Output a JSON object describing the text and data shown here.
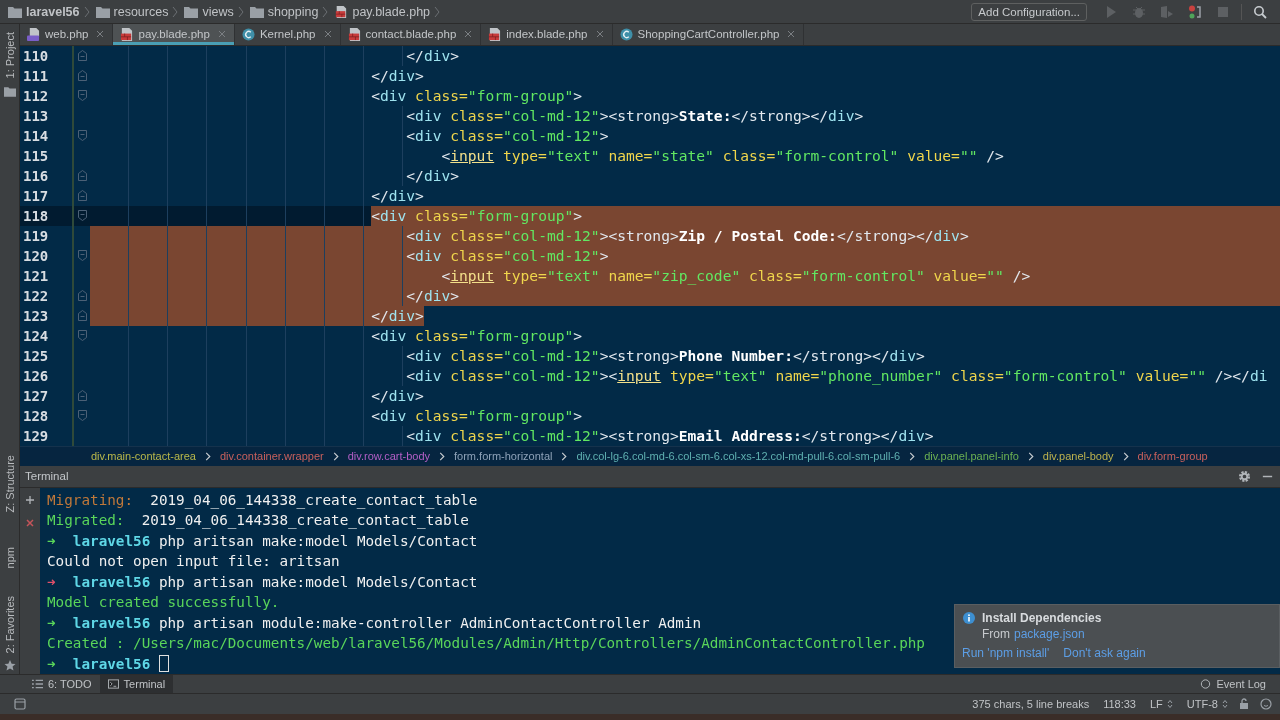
{
  "navbar": {
    "path": [
      {
        "label": "laravel56",
        "kind": "project"
      },
      {
        "label": "resources",
        "kind": "folder"
      },
      {
        "label": "views",
        "kind": "folder"
      },
      {
        "label": "shopping",
        "kind": "folder"
      },
      {
        "label": "pay.blade.php",
        "kind": "blade"
      }
    ],
    "config_button": "Add Configuration..."
  },
  "tool_strip": {
    "top": "1: Project",
    "bottom": [
      "Z: Structure",
      "npm",
      "2: Favorites"
    ]
  },
  "tabs": [
    {
      "label": "web.php",
      "kind": "php",
      "selected": false
    },
    {
      "label": "pay.blade.php",
      "kind": "blade",
      "selected": true
    },
    {
      "label": "Kernel.php",
      "kind": "class",
      "selected": false
    },
    {
      "label": "contact.blade.php",
      "kind": "blade",
      "selected": false
    },
    {
      "label": "index.blade.php",
      "kind": "blade",
      "selected": false
    },
    {
      "label": "ShoppingCartController.php",
      "kind": "class",
      "selected": false
    }
  ],
  "editor": {
    "lines": [
      {
        "number": "110",
        "fold_start": false,
        "fold_end": true,
        "current": false,
        "selected": false,
        "tokens": [
          {
            "kind": "p",
            "text": "                                    </"
          },
          {
            "kind": "tag",
            "text": "div"
          },
          {
            "kind": "p",
            "text": ">"
          }
        ]
      },
      {
        "number": "111",
        "fold_start": false,
        "fold_end": true,
        "current": false,
        "selected": false,
        "tokens": [
          {
            "kind": "p",
            "text": "                                </"
          },
          {
            "kind": "tag",
            "text": "div"
          },
          {
            "kind": "p",
            "text": ">"
          }
        ]
      },
      {
        "number": "112",
        "fold_start": true,
        "fold_end": false,
        "current": false,
        "selected": false,
        "tokens": [
          {
            "kind": "p",
            "text": "                                <"
          },
          {
            "kind": "tag",
            "text": "div"
          },
          {
            "kind": "attr",
            "text": " class="
          },
          {
            "kind": "str",
            "text": "\"form-group\""
          },
          {
            "kind": "p",
            "text": ">"
          }
        ]
      },
      {
        "number": "113",
        "fold_start": false,
        "fold_end": false,
        "current": false,
        "selected": false,
        "tokens": [
          {
            "kind": "p",
            "text": "                                    <"
          },
          {
            "kind": "tag",
            "text": "div"
          },
          {
            "kind": "attr",
            "text": " class="
          },
          {
            "kind": "str",
            "text": "\"col-md-12\""
          },
          {
            "kind": "p",
            "text": "><strong>"
          },
          {
            "kind": "txt",
            "text": "State:"
          },
          {
            "kind": "p",
            "text": "</strong></"
          },
          {
            "kind": "tag",
            "text": "div"
          },
          {
            "kind": "p",
            "text": ">"
          }
        ]
      },
      {
        "number": "114",
        "fold_start": true,
        "fold_end": false,
        "current": false,
        "selected": false,
        "tokens": [
          {
            "kind": "p",
            "text": "                                    <"
          },
          {
            "kind": "tag",
            "text": "div"
          },
          {
            "kind": "attr",
            "text": " class="
          },
          {
            "kind": "str",
            "text": "\"col-md-12\""
          },
          {
            "kind": "p",
            "text": ">"
          }
        ]
      },
      {
        "number": "115",
        "fold_start": false,
        "fold_end": false,
        "current": false,
        "selected": false,
        "tokens": [
          {
            "kind": "p",
            "text": "                                        <"
          },
          {
            "kind": "in",
            "text": "input"
          },
          {
            "kind": "attr",
            "text": " type="
          },
          {
            "kind": "str",
            "text": "\"text\""
          },
          {
            "kind": "attr",
            "text": " name="
          },
          {
            "kind": "str",
            "text": "\"state\""
          },
          {
            "kind": "attr",
            "text": " class="
          },
          {
            "kind": "str",
            "text": "\"form-control\""
          },
          {
            "kind": "attr",
            "text": " value="
          },
          {
            "kind": "str",
            "text": "\"\""
          },
          {
            "kind": "p",
            "text": " />"
          }
        ]
      },
      {
        "number": "116",
        "fold_start": false,
        "fold_end": true,
        "current": false,
        "selected": false,
        "tokens": [
          {
            "kind": "p",
            "text": "                                    </"
          },
          {
            "kind": "tag",
            "text": "div"
          },
          {
            "kind": "p",
            "text": ">"
          }
        ]
      },
      {
        "number": "117",
        "fold_start": false,
        "fold_end": true,
        "current": false,
        "selected": false,
        "tokens": [
          {
            "kind": "p",
            "text": "                                </"
          },
          {
            "kind": "tag",
            "text": "div"
          },
          {
            "kind": "p",
            "text": ">"
          }
        ]
      },
      {
        "number": "118",
        "fold_start": true,
        "fold_end": false,
        "current": true,
        "selected": true,
        "tokens": [
          {
            "kind": "p",
            "text": "                                <"
          },
          {
            "kind": "tag",
            "text": "div"
          },
          {
            "kind": "attr",
            "text": " class="
          },
          {
            "kind": "str",
            "text": "\"form-group\""
          },
          {
            "kind": "p",
            "text": ">"
          }
        ]
      },
      {
        "number": "119",
        "fold_start": false,
        "fold_end": false,
        "current": false,
        "selected": true,
        "tokens": [
          {
            "kind": "p",
            "text": "                                    <"
          },
          {
            "kind": "tag",
            "text": "div"
          },
          {
            "kind": "attr",
            "text": " class="
          },
          {
            "kind": "str",
            "text": "\"col-md-12\""
          },
          {
            "kind": "p",
            "text": "><strong>"
          },
          {
            "kind": "txt",
            "text": "Zip / Postal Code:"
          },
          {
            "kind": "p",
            "text": "</strong></"
          },
          {
            "kind": "tag",
            "text": "div"
          },
          {
            "kind": "p",
            "text": ">"
          }
        ]
      },
      {
        "number": "120",
        "fold_start": true,
        "fold_end": false,
        "current": false,
        "selected": true,
        "tokens": [
          {
            "kind": "p",
            "text": "                                    <"
          },
          {
            "kind": "tag",
            "text": "div"
          },
          {
            "kind": "attr",
            "text": " class="
          },
          {
            "kind": "str",
            "text": "\"col-md-12\""
          },
          {
            "kind": "p",
            "text": ">"
          }
        ]
      },
      {
        "number": "121",
        "fold_start": false,
        "fold_end": false,
        "current": false,
        "selected": true,
        "tokens": [
          {
            "kind": "p",
            "text": "                                        <"
          },
          {
            "kind": "in",
            "text": "input"
          },
          {
            "kind": "attr",
            "text": " type="
          },
          {
            "kind": "str",
            "text": "\"text\""
          },
          {
            "kind": "attr",
            "text": " name="
          },
          {
            "kind": "str",
            "text": "\"zip_code\""
          },
          {
            "kind": "attr",
            "text": " class="
          },
          {
            "kind": "str",
            "text": "\"form-control\""
          },
          {
            "kind": "attr",
            "text": " value="
          },
          {
            "kind": "str",
            "text": "\"\""
          },
          {
            "kind": "p",
            "text": " />"
          }
        ]
      },
      {
        "number": "122",
        "fold_start": false,
        "fold_end": true,
        "current": false,
        "selected": true,
        "tokens": [
          {
            "kind": "p",
            "text": "                                    </"
          },
          {
            "kind": "tag",
            "text": "div"
          },
          {
            "kind": "p",
            "text": ">"
          }
        ]
      },
      {
        "number": "123",
        "fold_start": false,
        "fold_end": true,
        "current": false,
        "selected": true,
        "tokens": [
          {
            "kind": "p",
            "text": "                                </"
          },
          {
            "kind": "tag",
            "text": "div"
          },
          {
            "kind": "p",
            "text": ">"
          }
        ]
      },
      {
        "number": "124",
        "fold_start": true,
        "fold_end": false,
        "current": false,
        "selected": false,
        "tokens": [
          {
            "kind": "p",
            "text": "                                <"
          },
          {
            "kind": "tag",
            "text": "div"
          },
          {
            "kind": "attr",
            "text": " class="
          },
          {
            "kind": "str",
            "text": "\"form-group\""
          },
          {
            "kind": "p",
            "text": ">"
          }
        ]
      },
      {
        "number": "125",
        "fold_start": false,
        "fold_end": false,
        "current": false,
        "selected": false,
        "tokens": [
          {
            "kind": "p",
            "text": "                                    <"
          },
          {
            "kind": "tag",
            "text": "div"
          },
          {
            "kind": "attr",
            "text": " class="
          },
          {
            "kind": "str",
            "text": "\"col-md-12\""
          },
          {
            "kind": "p",
            "text": "><strong>"
          },
          {
            "kind": "txt",
            "text": "Phone Number:"
          },
          {
            "kind": "p",
            "text": "</strong></"
          },
          {
            "kind": "tag",
            "text": "div"
          },
          {
            "kind": "p",
            "text": ">"
          }
        ]
      },
      {
        "number": "126",
        "fold_start": false,
        "fold_end": false,
        "current": false,
        "selected": false,
        "tokens": [
          {
            "kind": "p",
            "text": "                                    <"
          },
          {
            "kind": "tag",
            "text": "div"
          },
          {
            "kind": "attr",
            "text": " class="
          },
          {
            "kind": "str",
            "text": "\"col-md-12\""
          },
          {
            "kind": "p",
            "text": "><"
          },
          {
            "kind": "in",
            "text": "input"
          },
          {
            "kind": "attr",
            "text": " type="
          },
          {
            "kind": "str",
            "text": "\"text\""
          },
          {
            "kind": "attr",
            "text": " name="
          },
          {
            "kind": "str",
            "text": "\"phone_number\""
          },
          {
            "kind": "attr",
            "text": " class="
          },
          {
            "kind": "str",
            "text": "\"form-control\""
          },
          {
            "kind": "attr",
            "text": " value="
          },
          {
            "kind": "str",
            "text": "\"\""
          },
          {
            "kind": "p",
            "text": " /></"
          },
          {
            "kind": "tag",
            "text": "di"
          }
        ]
      },
      {
        "number": "127",
        "fold_start": false,
        "fold_end": true,
        "current": false,
        "selected": false,
        "tokens": [
          {
            "kind": "p",
            "text": "                                </"
          },
          {
            "kind": "tag",
            "text": "div"
          },
          {
            "kind": "p",
            "text": ">"
          }
        ]
      },
      {
        "number": "128",
        "fold_start": true,
        "fold_end": false,
        "current": false,
        "selected": false,
        "tokens": [
          {
            "kind": "p",
            "text": "                                <"
          },
          {
            "kind": "tag",
            "text": "div"
          },
          {
            "kind": "attr",
            "text": " class="
          },
          {
            "kind": "str",
            "text": "\"form-group\""
          },
          {
            "kind": "p",
            "text": ">"
          }
        ]
      },
      {
        "number": "129",
        "fold_start": false,
        "fold_end": false,
        "current": false,
        "selected": false,
        "tokens": [
          {
            "kind": "p",
            "text": "                                    <"
          },
          {
            "kind": "tag",
            "text": "div"
          },
          {
            "kind": "attr",
            "text": " class="
          },
          {
            "kind": "str",
            "text": "\"col-md-12\""
          },
          {
            "kind": "p",
            "text": "><strong>"
          },
          {
            "kind": "txt",
            "text": "Email Address:"
          },
          {
            "kind": "p",
            "text": "</strong></"
          },
          {
            "kind": "tag",
            "text": "div"
          },
          {
            "kind": "p",
            "text": ">"
          }
        ]
      }
    ]
  },
  "breadcrumbs": [
    {
      "label": "div.main-contact-area",
      "color": "#b9b84a"
    },
    {
      "label": "div.container.wrapper",
      "color": "#c8605c"
    },
    {
      "label": "div.row.cart-body",
      "color": "#b45fc6"
    },
    {
      "label": "form.form-horizontal",
      "color": "#8ea2b8"
    },
    {
      "label": "div.col-lg-6.col-md-6.col-sm-6.col-xs-12.col-md-pull-6.col-sm-pull-6",
      "color": "#5fb0b0"
    },
    {
      "label": "div.panel.panel-info",
      "color": "#6cb152"
    },
    {
      "label": "div.panel-body",
      "color": "#bdb24e"
    },
    {
      "label": "div.form-group",
      "color": "#c8605c"
    }
  ],
  "terminal": {
    "title": "Terminal",
    "lines": [
      [
        {
          "kind": "warn",
          "text": "Migrating:"
        },
        {
          "kind": "plain",
          "text": "  2019_04_06_144338_create_contact_table"
        }
      ],
      [
        {
          "kind": "ok",
          "text": "Migrated:"
        },
        {
          "kind": "plain",
          "text": "  2019_04_06_144338_create_contact_table"
        }
      ],
      [
        {
          "kind": "arrow",
          "text": "➜ "
        },
        {
          "kind": "dir",
          "text": " laravel56"
        },
        {
          "kind": "plain",
          "text": " php aritsan make:model Models/Contact"
        }
      ],
      [
        {
          "kind": "plain",
          "text": "Could not open input file: aritsan"
        }
      ],
      [
        {
          "kind": "arrow_err",
          "text": "➜ "
        },
        {
          "kind": "dir",
          "text": " laravel56"
        },
        {
          "kind": "plain",
          "text": " php artisan make:model Models/Contact"
        }
      ],
      [
        {
          "kind": "ok",
          "text": "Model created successfully."
        }
      ],
      [
        {
          "kind": "arrow",
          "text": "➜ "
        },
        {
          "kind": "dir",
          "text": " laravel56"
        },
        {
          "kind": "plain",
          "text": " php artisan module:make-controller AdminContactController Admin"
        }
      ],
      [
        {
          "kind": "ok",
          "text": "Created : /Users/mac/Documents/web/laravel56/Modules/Admin/Http/Controllers/AdminContactController.php"
        }
      ],
      [
        {
          "kind": "arrow",
          "text": "➜ "
        },
        {
          "kind": "dir",
          "text": " laravel56"
        }
      ]
    ]
  },
  "notification": {
    "title": "Install Dependencies",
    "from": "From",
    "link": "package.json",
    "actions": [
      "Run 'npm install'",
      "Don't ask again"
    ]
  },
  "bottom_tools": [
    {
      "label": "6: TODO",
      "kind": "todo",
      "selected": false
    },
    {
      "label": "Terminal",
      "kind": "terminal",
      "selected": true
    }
  ],
  "event_log": "Event Log",
  "status_bar": {
    "selection_info": "375 chars, 5 line breaks",
    "position": "118:33",
    "line_separator": "LF",
    "encoding": "UTF-8"
  }
}
